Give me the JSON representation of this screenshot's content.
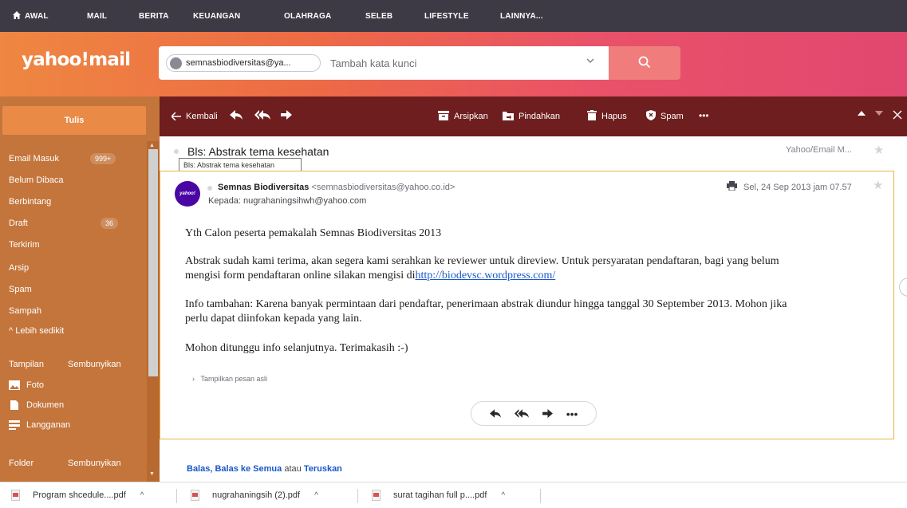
{
  "topnav": {
    "items": [
      "AWAL",
      "MAIL",
      "BERITA",
      "KEUANGAN",
      "OLAHRAGA",
      "SELEB",
      "LIFESTYLE",
      "LAINNYA..."
    ]
  },
  "header": {
    "logo": "yahoo!mail",
    "search_chip": "semnasbiodiversitas@ya...",
    "search_placeholder": "Tambah kata kunci"
  },
  "sidebar": {
    "compose": "Tulis",
    "folders": [
      {
        "label": "Email Masuk",
        "badge": "999+"
      },
      {
        "label": "Belum Dibaca"
      },
      {
        "label": "Berbintang"
      },
      {
        "label": "Draft",
        "badge": "36"
      },
      {
        "label": "Terkirim"
      },
      {
        "label": "Arsip"
      },
      {
        "label": "Spam"
      },
      {
        "label": "Sampah"
      },
      {
        "label": "^ Lebih sedikit"
      }
    ],
    "views_label": "Tampilan",
    "views_toggle": "Sembunyikan",
    "views": [
      "Foto",
      "Dokumen",
      "Langganan"
    ],
    "folder_label": "Folder",
    "folder_toggle": "Sembunyikan"
  },
  "toolbar": {
    "back": "Kembali",
    "archive": "Arsipkan",
    "move": "Pindahkan",
    "delete": "Hapus",
    "spam": "Spam",
    "more": "•••"
  },
  "message": {
    "subject": "Bls: Abstrak tema kesehatan",
    "tooltip": "Bls: Abstrak tema kesehatan",
    "folder": "Yahoo/Email M...",
    "avatar_text": "yahoo!",
    "sender_name": "Semnas Biodiversitas",
    "sender_email": "<semnasbiodiversitas@yahoo.co.id>",
    "recipient": "Kepada: nugrahaningsihwh@yahoo.com",
    "date": "Sel, 24 Sep 2013 jam 07.57",
    "body": {
      "greeting": "Yth Calon peserta pemakalah Semnas Biodiversitas 2013",
      "p1_line1": "Abstrak sudah kami terima, akan segera kami serahkan ke reviewer untuk direview. Untuk persyaratan pendaftaran, bagi yang belum",
      "p1_line2": "mengisi form pendaftaran online silakan mengisi di",
      "link": "http://biodevsc.wordpress.com/",
      "p2_line1": "Info tambahan: Karena banyak permintaan dari pendaftar, penerimaan abstrak diundur hingga tanggal 30 September 2013. Mohon jika",
      "p2_line2": "perlu dapat diinfokan kepada yang lain.",
      "closing": "Mohon ditunggu info selanjutnya. Terimakasih :-)"
    },
    "show_original": "Tampilkan pesan asli",
    "more": "•••"
  },
  "reply_links": {
    "reply": "Balas",
    "reply_all": "Balas ke Semua",
    "or": "atau",
    "forward": "Teruskan"
  },
  "downloads": [
    "Program shcedule....pdf",
    "nugrahaningsih (2).pdf",
    "surat tagihan full p....pdf"
  ]
}
